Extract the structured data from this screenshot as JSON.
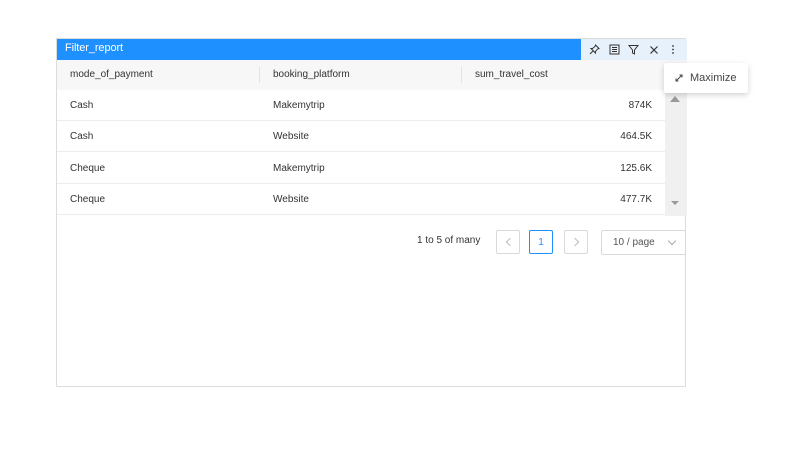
{
  "widget": {
    "title": "Filter_report",
    "toolbar": [
      {
        "name": "pin-icon"
      },
      {
        "name": "table-view-icon"
      },
      {
        "name": "filter-icon"
      },
      {
        "name": "close-icon"
      },
      {
        "name": "more-options-icon"
      }
    ]
  },
  "table": {
    "columns": [
      "mode_of_payment",
      "booking_platform",
      "sum_travel_cost"
    ],
    "rows": [
      [
        "Cash",
        "Makemytrip",
        "874K"
      ],
      [
        "Cash",
        "Website",
        "464.5K"
      ],
      [
        "Cheque",
        "Makemytrip",
        "125.6K"
      ],
      [
        "Cheque",
        "Website",
        "477.7K"
      ]
    ]
  },
  "pagination": {
    "info": "1 to 5 of many",
    "current_page": "1",
    "page_size": "10 / page"
  },
  "menu": {
    "maximize_label": "Maximize"
  },
  "colors": {
    "titlebar": "#1e90ff",
    "toolbar_bg": "#e6f1fb",
    "active_page": "#1e90ff"
  }
}
